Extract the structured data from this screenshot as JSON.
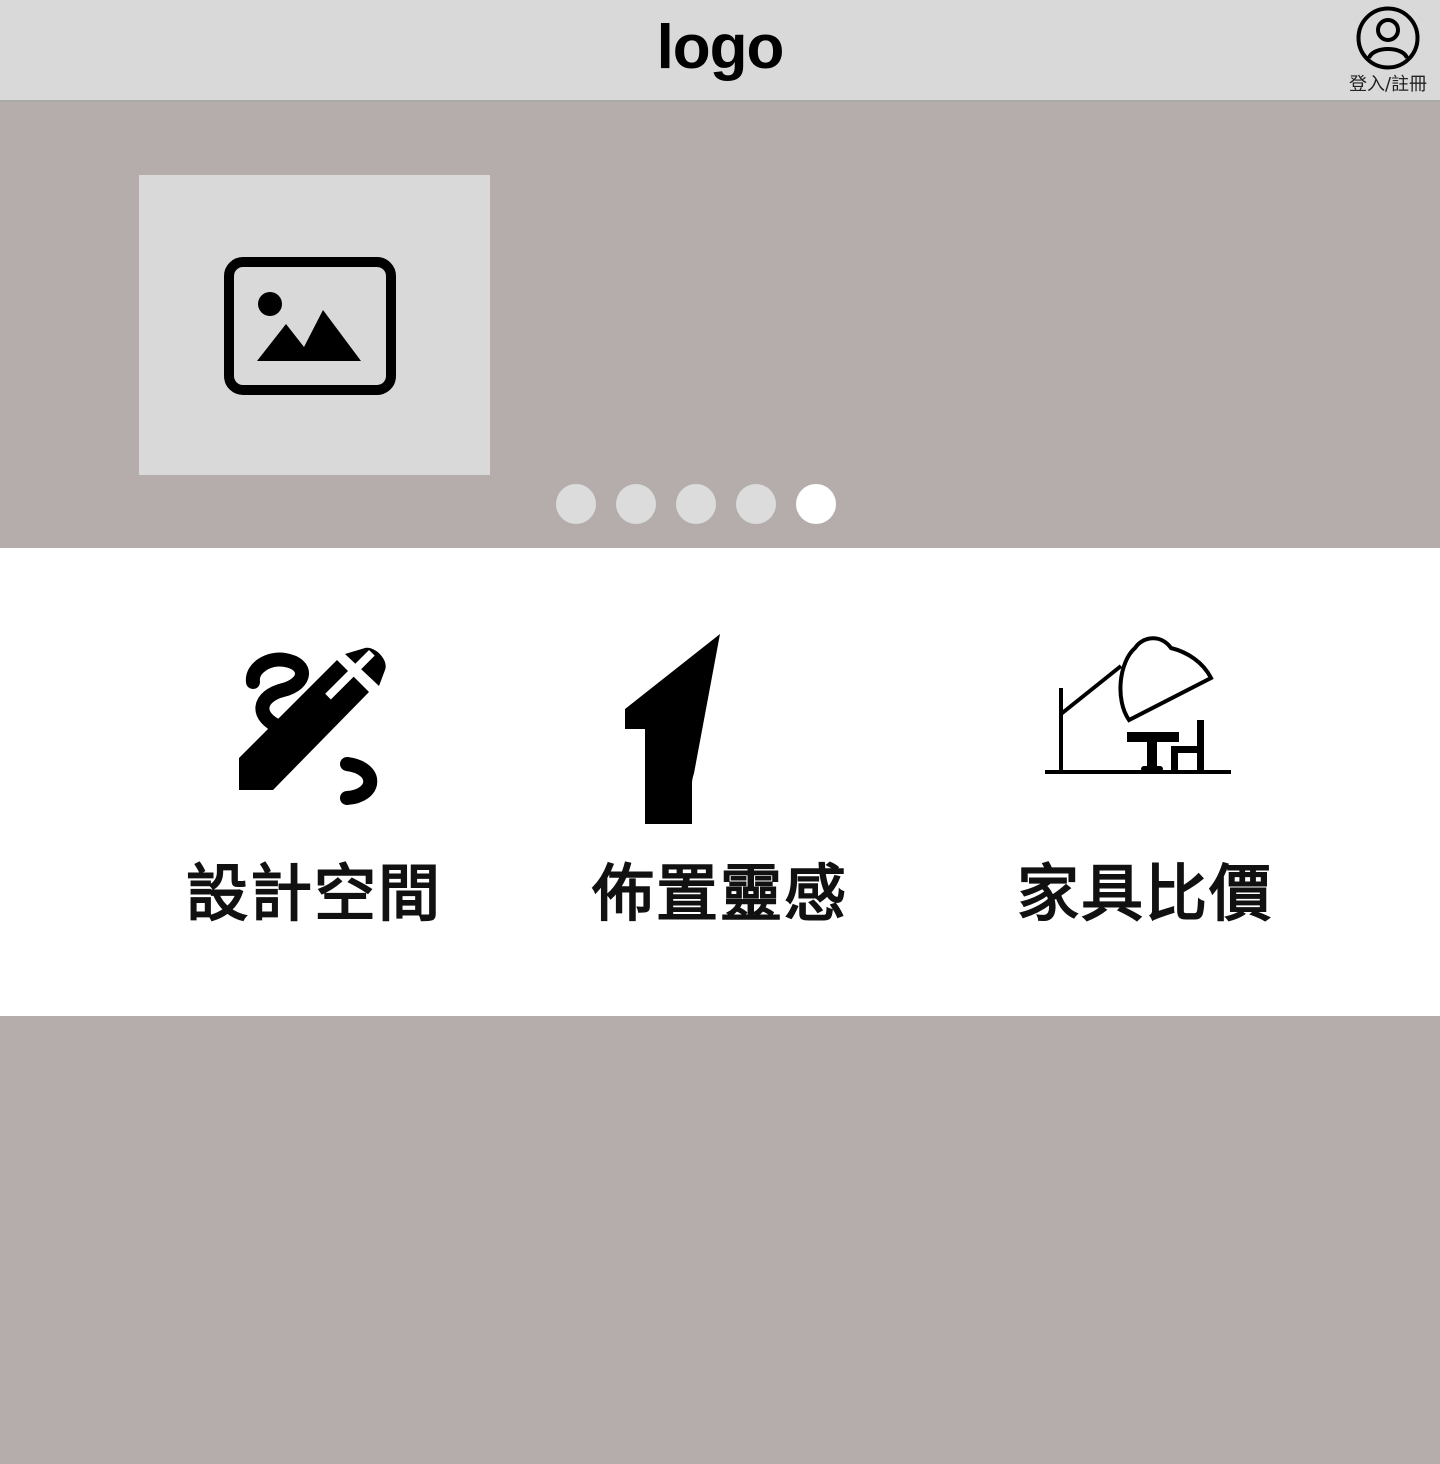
{
  "header": {
    "logo_text": "logo",
    "login_label": "登入/註冊",
    "login_icon": "user-circle-icon"
  },
  "hero": {
    "image_icon": "image-placeholder-icon",
    "carousel": {
      "slide_count": 5,
      "active_index": 4
    }
  },
  "features": [
    {
      "label": "設計空間",
      "icon": "pencil-draw-icon"
    },
    {
      "label": "佈置靈感",
      "icon": "house-icon"
    },
    {
      "label": "家具比價",
      "icon": "desk-lamp-furniture-icon"
    }
  ],
  "colors": {
    "header_bg": "#d9d9d9",
    "hero_bg": "#b5adab",
    "placeholder_bg": "#d9d9d9",
    "dot_inactive": "#dcdcdc",
    "dot_active": "#ffffff",
    "features_bg": "#ffffff"
  }
}
